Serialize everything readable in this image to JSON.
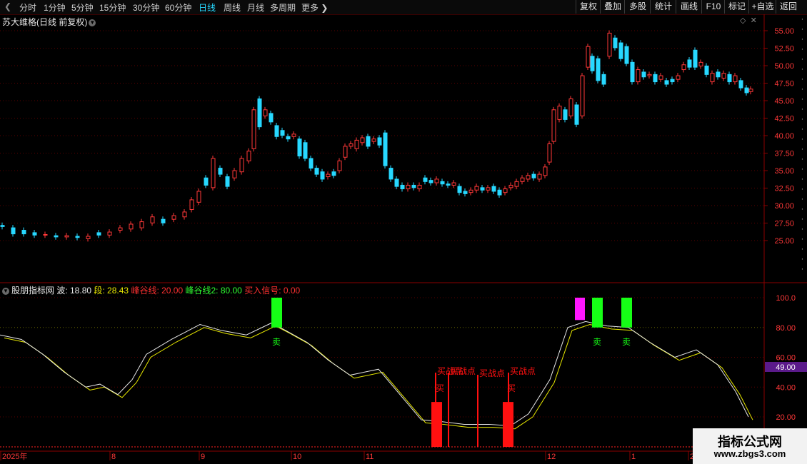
{
  "toolbar": {
    "periods": [
      "分时",
      "1分钟",
      "5分钟",
      "15分钟",
      "30分钟",
      "60分钟",
      "日线",
      "周线",
      "月线",
      "多周期",
      "更多"
    ],
    "active_period": "日线",
    "right_buttons": [
      "复权",
      "叠加",
      "多股",
      "统计",
      "画线",
      "F10",
      "标记",
      "+自选",
      "返回"
    ]
  },
  "price_panel": {
    "title": "苏大维格(日线 前复权)",
    "y_labels": [
      "55.00",
      "52.50",
      "50.00",
      "47.50",
      "45.00",
      "42.50",
      "40.00",
      "37.50",
      "35.00",
      "32.50",
      "30.00",
      "27.50",
      "25.00"
    ]
  },
  "indicator": {
    "name": "股朋指标网",
    "values": [
      {
        "label": "波: 18.80",
        "color": "#e8e8e8"
      },
      {
        "label": "段: 28.43",
        "color": "#e8e800"
      },
      {
        "label": "峰谷线: 20.00",
        "color": "#ff3030"
      },
      {
        "label": "峰谷线2: 80.00",
        "color": "#30ff30"
      },
      {
        "label": "买入信号: 0.00",
        "color": "#ff3030"
      }
    ],
    "y_labels": [
      "100.0",
      "80.00",
      "60.00",
      "40.00",
      "20.00"
    ],
    "current_value": "49.00",
    "sell_label": "卖",
    "buy_label": "买",
    "buy_point_label": "买战点"
  },
  "x_axis_labels": [
    "2025年",
    "8",
    "9",
    "10",
    "11",
    "12",
    "1",
    "2"
  ],
  "watermark": {
    "line1": "指标公式网",
    "line2": "www.zbgs3.com"
  },
  "colors": {
    "up": "#ff3838",
    "down": "#27d8ff",
    "grid": "#5a0000",
    "sell": "#16ff16",
    "magenta": "#ff16ff",
    "buy": "#ff1010"
  }
}
